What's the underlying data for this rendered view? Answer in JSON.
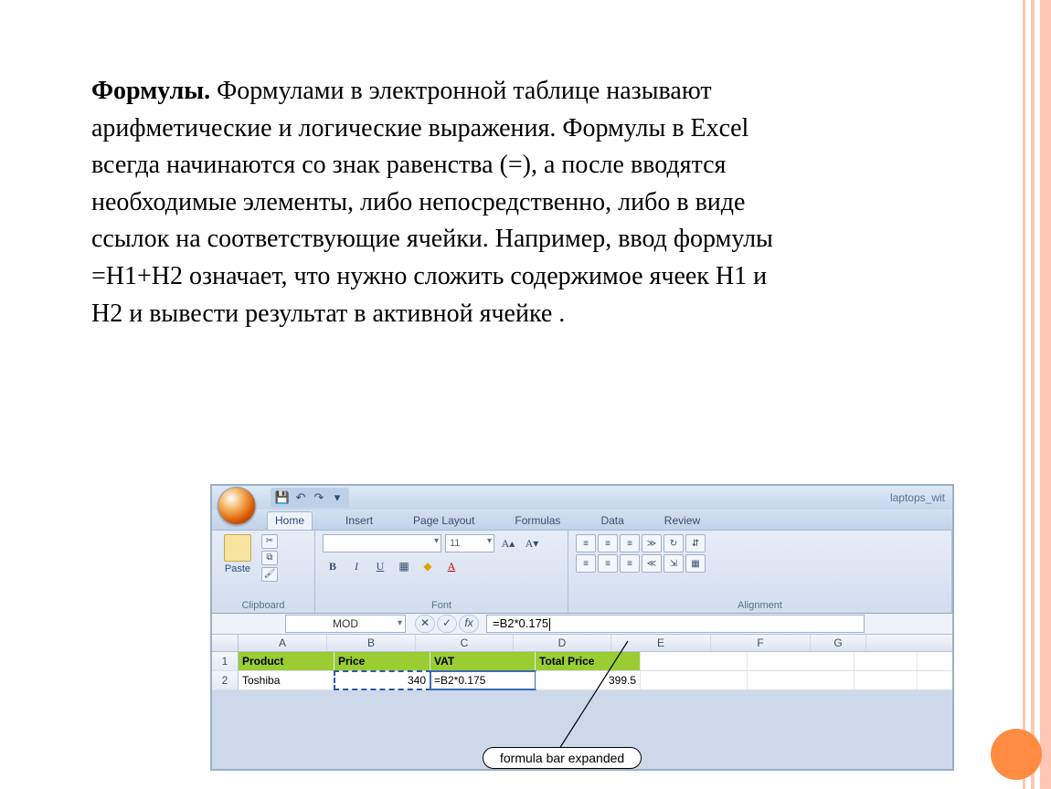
{
  "slide": {
    "para_bold": "Формулы.",
    "para_rest": " Формулами в электронной таблице называют арифметические и логические выражения. Формулы в Excel всегда начинаются со знак равенства (=), а после вводятся необходимые элементы, либо непосредственно, либо в виде ссылок на соответствующие ячейки. Например, ввод формулы =H1+H2 означает, что нужно сложить содержимое ячеек H1 и H2 и вывести результат в активной ячейке ."
  },
  "excel": {
    "title": "laptops_wit",
    "qat": {
      "save": "💾",
      "undo": "↶",
      "redo": "↷",
      "more": "▾"
    },
    "tabs": [
      "Home",
      "Insert",
      "Page Layout",
      "Formulas",
      "Data",
      "Review"
    ],
    "active_tab": "Home",
    "groups": {
      "clipboard": {
        "label": "Clipboard",
        "paste": "Paste",
        "cut": "✂",
        "copy": "⧉",
        "painter": "🖌"
      },
      "font": {
        "label": "Font",
        "font_name": "",
        "font_size": "11",
        "grow": "A▴",
        "shrink": "A▾",
        "bold": "B",
        "italic": "I",
        "underline": "U",
        "border": "▦",
        "fill": "◆",
        "color": "A"
      },
      "alignment": {
        "label": "Alignment",
        "btns": [
          "≡",
          "≡",
          "≡",
          "≫",
          "↻",
          "⇵",
          "≡",
          "≡",
          "≡",
          "≪",
          "⇲",
          "▦"
        ]
      }
    },
    "formula_bar": {
      "namebox": "MOD",
      "cancel": "✕",
      "enter": "✓",
      "fx": "fx",
      "value": "=B2*0.175"
    },
    "columns": [
      "A",
      "B",
      "C",
      "D",
      "E",
      "F",
      "G"
    ],
    "rows": [
      {
        "n": "1",
        "cells": [
          "Product",
          "Price",
          "VAT",
          "Total Price",
          "",
          "",
          ""
        ],
        "hdr": true
      },
      {
        "n": "2",
        "cells": [
          "Toshiba",
          "340",
          "=B2*0.175",
          "399.5",
          "",
          "",
          ""
        ],
        "hdr": false
      }
    ],
    "callout": "formula bar expanded"
  }
}
